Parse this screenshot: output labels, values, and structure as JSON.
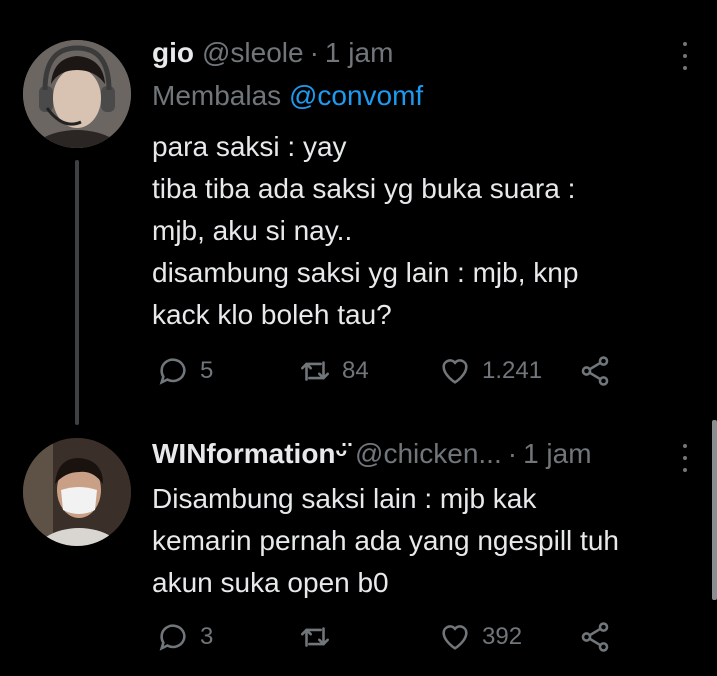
{
  "colors": {
    "background": "#000000",
    "text": "#e7e9ea",
    "muted": "#71767b",
    "link": "#1d9bf0",
    "thread_line": "#3e4144"
  },
  "tweets": [
    {
      "name": "gio",
      "handle": "@sleole",
      "separator": "·",
      "time": "1 jam",
      "replying_label": "Membalas",
      "replying_to": "@convomf",
      "lines": [
        "para saksi : yay",
        "tiba tiba ada saksi yg buka suara :",
        "mjb, aku si nay..",
        "disambung saksi yg lain : mjb, knp",
        "kack klo boleh tau?"
      ],
      "reply_count": "5",
      "retweet_count": "84",
      "like_count": "1.241",
      "icons": [
        "reply-icon",
        "retweet-icon",
        "like-icon",
        "share-icon",
        "more-icon"
      ]
    },
    {
      "name": "WINformation",
      "name_emoji": "ᵕ̈",
      "handle": "@chicken...",
      "separator": "·",
      "time": "1 jam",
      "lines": [
        "Disambung saksi lain : mjb kak",
        "kemarin pernah ada yang ngespill tuh",
        "akun suka open b0"
      ],
      "reply_count": "3",
      "retweet_count": "",
      "like_count": "392",
      "icons": [
        "reply-icon",
        "retweet-icon",
        "like-icon",
        "share-icon",
        "more-icon"
      ]
    }
  ]
}
